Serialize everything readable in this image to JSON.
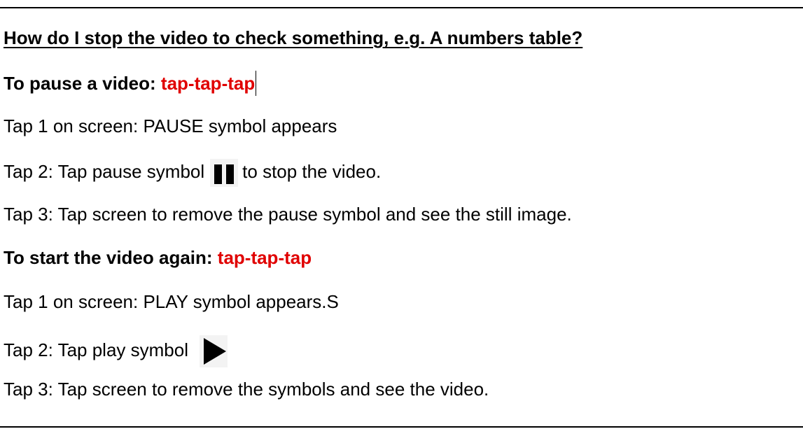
{
  "heading": "How do I stop the video to check something, e.g. A numbers table?",
  "pause_section": {
    "title": "To pause a video: ",
    "action": "tap-tap-tap",
    "step1": "Tap 1 on screen: PAUSE symbol appears",
    "step2_before": "Tap 2: Tap pause symbol",
    "step2_after": "to stop the video.",
    "step3": "Tap 3: Tap screen to remove the pause symbol and see the still image."
  },
  "play_section": {
    "title": "To start the video again: ",
    "action": "tap-tap-tap",
    "step1": "Tap 1 on screen: PLAY symbol appears.S",
    "step2_before": "Tap 2: Tap play symbol",
    "step3": "Tap 3: Tap screen to remove the symbols and see the video."
  },
  "icons": {
    "pause": "pause-icon",
    "play": "play-icon"
  },
  "colors": {
    "accent_red": "#e00000",
    "text": "#000000",
    "icon_bg": "#f3f3f3"
  }
}
